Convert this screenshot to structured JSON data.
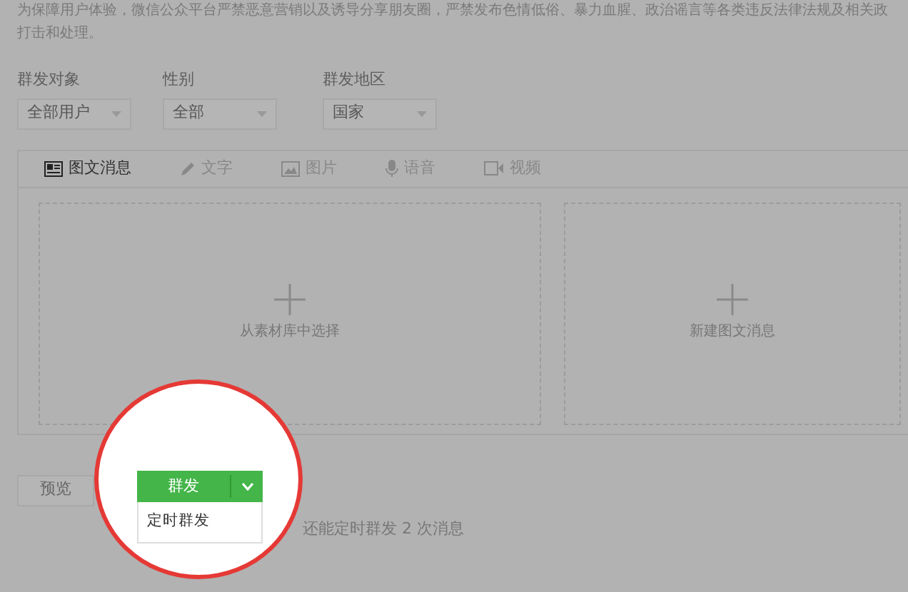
{
  "notice": [
    "为保障用户体验，微信公众平台严禁恶意营销以及诱导分享朋友圈，严禁发布色情低俗、暴力血腥、政治谣言等各类违反法律法规及相关政",
    "打击和处理。"
  ],
  "filters": [
    {
      "label": "群发对象",
      "value": "全部用户"
    },
    {
      "label": "性别",
      "value": "全部"
    },
    {
      "label": "群发地区",
      "value": "国家"
    }
  ],
  "tabs": [
    {
      "label": "图文消息",
      "kind": "news",
      "selected": true
    },
    {
      "label": "文字",
      "kind": "text",
      "selected": false
    },
    {
      "label": "图片",
      "kind": "image",
      "selected": false
    },
    {
      "label": "语音",
      "kind": "voice",
      "selected": false
    },
    {
      "label": "视频",
      "kind": "video",
      "selected": false
    }
  ],
  "cards": [
    {
      "label": "从素材库中选择"
    },
    {
      "label": "新建图文消息"
    }
  ],
  "preview_button": "预览",
  "send_button": {
    "label": "群发",
    "expanded": true
  },
  "send_menu": [
    "定时群发"
  ],
  "quota_text": "还能定时群发 2 次消息"
}
